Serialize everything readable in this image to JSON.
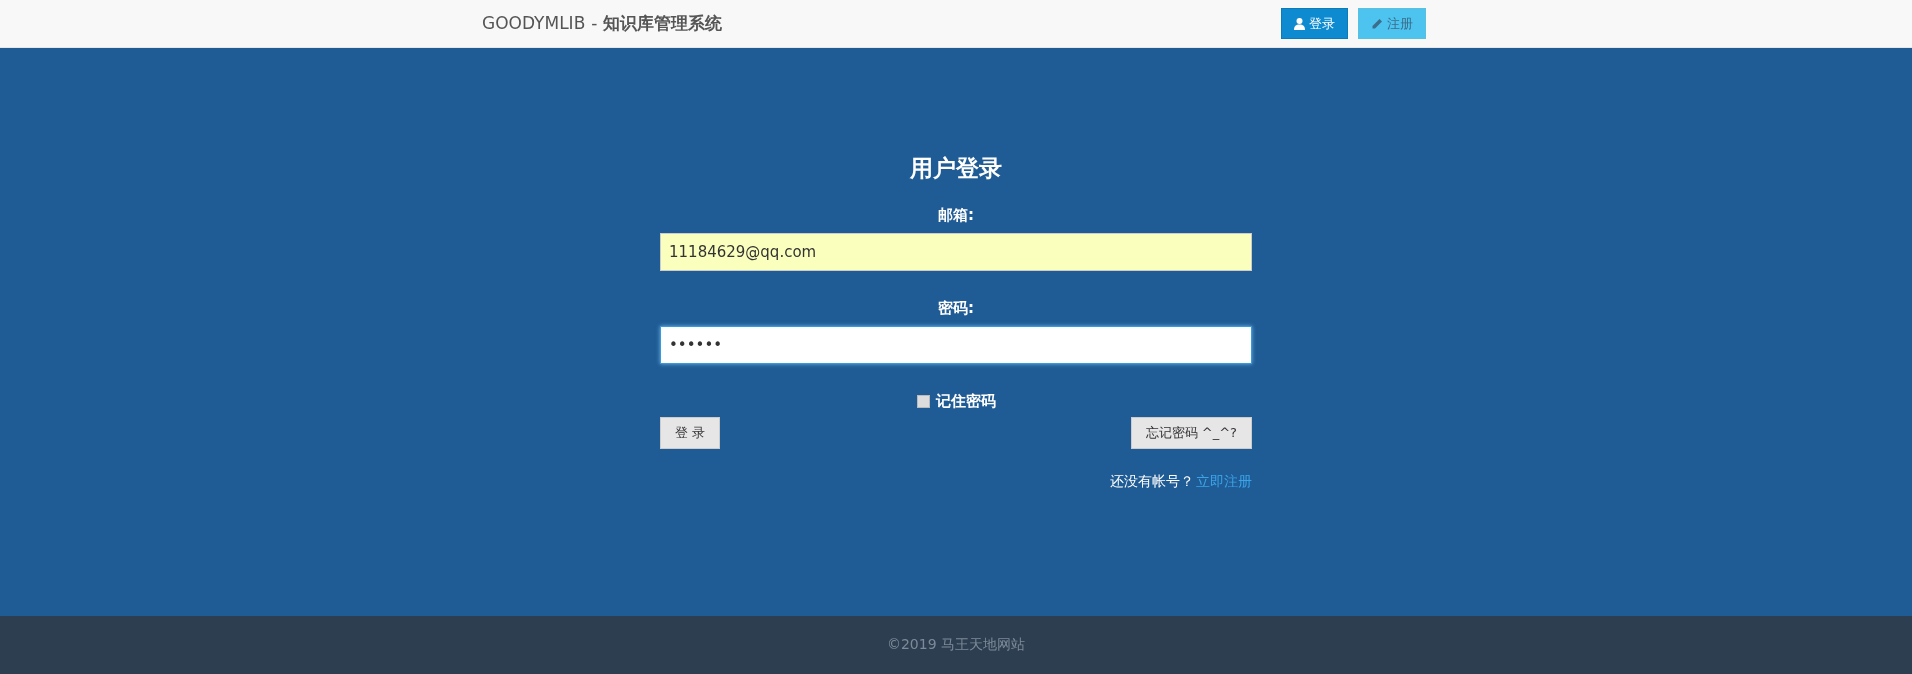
{
  "header": {
    "brand": "GOODYMLIB",
    "separator": "-",
    "title": "知识库管理系统",
    "buttons": [
      {
        "label": "登录",
        "kind": "user",
        "selected": true
      },
      {
        "label": "注册",
        "kind": "edit",
        "selected": false
      }
    ]
  },
  "login": {
    "heading": "用户登录",
    "fields": [
      {
        "label": "邮箱:",
        "value": "11184629@qq.com",
        "autofilled": true,
        "focused": false
      },
      {
        "label": "密码:",
        "value": "••••••",
        "autofilled": false,
        "focused": true
      }
    ],
    "remember": {
      "label": "记住密码",
      "checked": false
    },
    "submit": "登 录",
    "forgot": "忘记密码 ^_^?",
    "signup_prompt": "还没有帐号？",
    "signup_link": "立即注册"
  },
  "footer": {
    "text": "©2019 马王天地网站"
  }
}
